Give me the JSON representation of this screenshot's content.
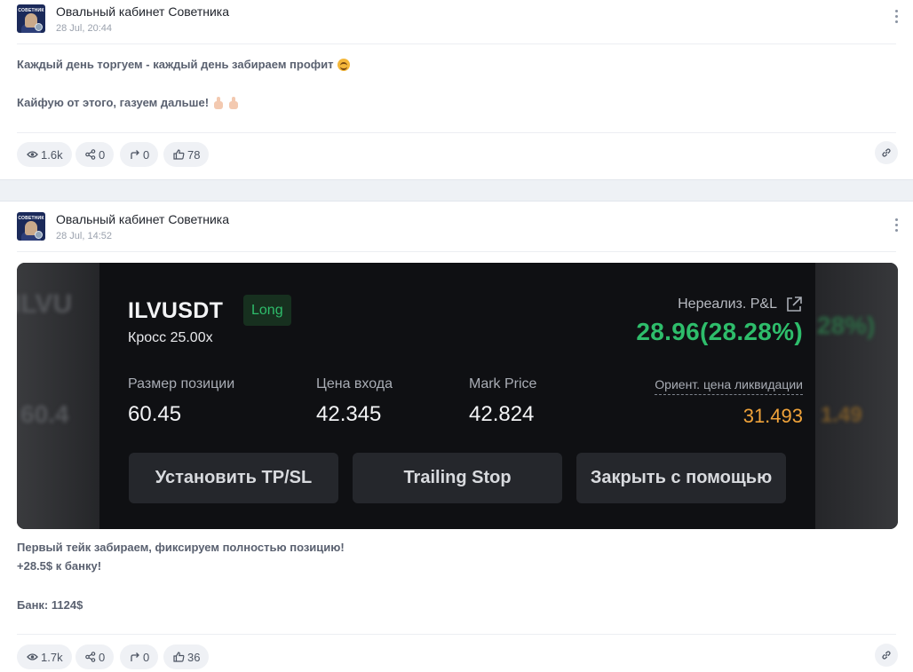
{
  "channel": {
    "name": "Овальный кабинет Советника",
    "avatar_text": "СОВЕТНИК"
  },
  "posts": [
    {
      "date": "28 Jul, 20:44",
      "lines": [
        "Каждый день торгуем - каждый день забираем профит",
        "Кайфую от этого, газуем дальше!"
      ],
      "stats": {
        "views": "1.6k",
        "shares": "0",
        "forwards": "0",
        "likes": "78"
      }
    },
    {
      "date": "28 Jul, 14:52",
      "lines": [
        "Первый тейк забираем, фиксируем полностью позицию!",
        "+28.5$ к банку!",
        "Банк: 1124$"
      ],
      "stats": {
        "views": "1.7k",
        "shares": "0",
        "forwards": "0",
        "likes": "36"
      }
    }
  ],
  "trade": {
    "symbol": "ILVUSDT",
    "side": "Long",
    "margin_mode": "Кросс 25.00x",
    "pnl_label": "Нереализ. P&L",
    "pnl_value": "28.96(28.28%)",
    "fields": [
      {
        "label": "Размер позиции",
        "value": "60.45"
      },
      {
        "label": "Цена входа",
        "value": "42.345"
      },
      {
        "label": "Mark Price",
        "value": "42.824"
      }
    ],
    "liq_label": "Ориент. цена ликвидации",
    "liq_value": "31.493",
    "buttons": [
      "Установить TP/SL",
      "Trailing Stop",
      "Закрыть с помощью"
    ],
    "colors": {
      "profit": "#2ebd6b",
      "liquidation": "#f0a33a",
      "panel": "#0f1013"
    }
  },
  "icons": [
    "eye-icon",
    "share-icon",
    "forward-icon",
    "thumbs-up-icon",
    "link-icon",
    "more-vertical-icon",
    "external-link-icon"
  ]
}
